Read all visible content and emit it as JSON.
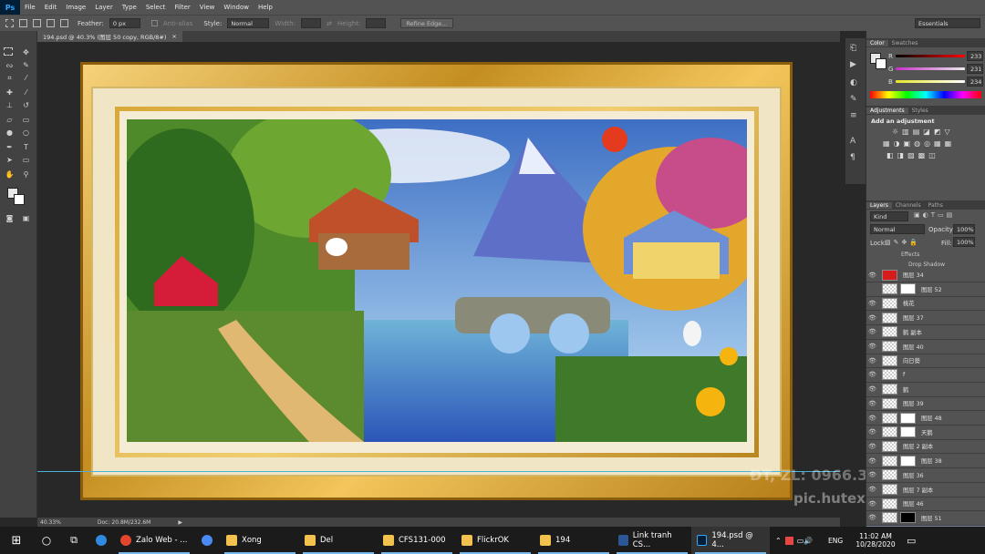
{
  "app": {
    "logo": "Ps",
    "menu": [
      "File",
      "Edit",
      "Image",
      "Layer",
      "Type",
      "Select",
      "Filter",
      "View",
      "Window",
      "Help"
    ]
  },
  "options": {
    "feather_label": "Feather:",
    "feather_value": "0 px",
    "antialias": "Anti-alias",
    "style_label": "Style:",
    "style_value": "Normal",
    "width_label": "Width:",
    "height_label": "Height:",
    "refine": "Refine Edge...",
    "workspace": "Essentials"
  },
  "document": {
    "tab": "194.psd @ 40.3% (图层 50 copy, RGB/8#)",
    "zoom": "40.33%",
    "doc_size": "Doc: 20.8M/232.6M"
  },
  "color_panel": {
    "tabs": [
      "Color",
      "Swatches"
    ],
    "r_label": "R",
    "g_label": "G",
    "b_label": "B",
    "r": "233",
    "g": "231",
    "b": "234"
  },
  "adjustments": {
    "tabs": [
      "Adjustments",
      "Styles"
    ],
    "title": "Add an adjustment"
  },
  "layers_panel": {
    "tabs": [
      "Layers",
      "Channels",
      "Paths"
    ],
    "kind": "Kind",
    "blend": "Normal",
    "opacity_label": "Opacity:",
    "opacity": "100%",
    "lock_label": "Lock:",
    "fill_label": "Fill:",
    "fill": "100%",
    "effects": "Effects",
    "drop_shadow": "Drop Shadow",
    "layers": [
      "图层 34",
      "图层 52",
      "桃花",
      "图层 37",
      "鹤 副本",
      "图层 40",
      "向日葵",
      "f",
      "鹤",
      "图层 39",
      "图层 48",
      "天鹅",
      "图层 2 副本",
      "图层 38",
      "图层 36",
      "图层 7 副本",
      "图层 46",
      "图层 51",
      "图层 50 copy"
    ]
  },
  "watermark": {
    "line1": "ĐT, ZL: 0966.3x.6625",
    "line2": "pic.hutexd..."
  },
  "taskbar": {
    "apps": [
      "Zalo Web - ...",
      "Xong",
      "Del",
      "CFS131-000",
      "FlickrOK",
      "194",
      "Link tranh CS...",
      "194.psd @ 4..."
    ],
    "lang": "ENG",
    "time": "11:02 AM",
    "date": "10/28/2020"
  },
  "colors": {
    "ps_bg": "#535353",
    "accent": "#31a8ff",
    "frame_gold": "#d9a83a"
  }
}
